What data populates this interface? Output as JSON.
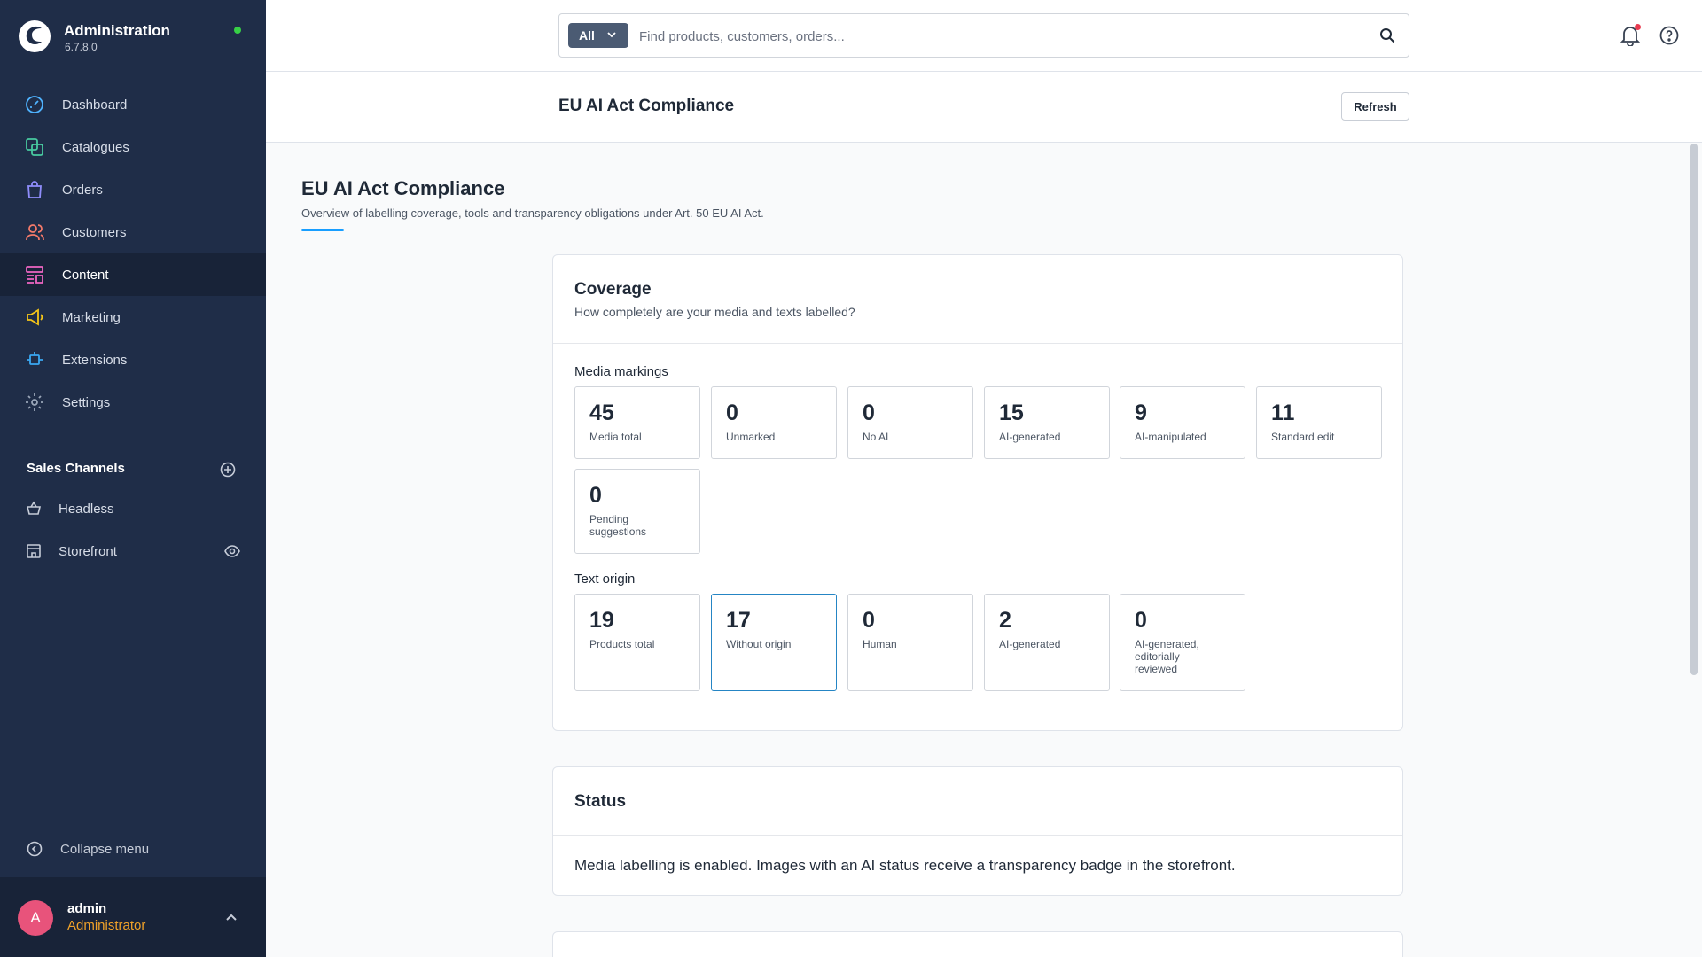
{
  "brand": {
    "name": "Administration",
    "version": "6.7.8.0"
  },
  "nav": [
    {
      "label": "Dashboard",
      "icon": "dashboard-icon"
    },
    {
      "label": "Catalogues",
      "icon": "catalogues-icon"
    },
    {
      "label": "Orders",
      "icon": "orders-icon"
    },
    {
      "label": "Customers",
      "icon": "customers-icon"
    },
    {
      "label": "Content",
      "icon": "content-icon",
      "active": true
    },
    {
      "label": "Marketing",
      "icon": "marketing-icon"
    },
    {
      "label": "Extensions",
      "icon": "extensions-icon"
    },
    {
      "label": "Settings",
      "icon": "settings-icon"
    }
  ],
  "sales_channels": {
    "title": "Sales Channels",
    "items": [
      {
        "label": "Headless",
        "icon": "basket-icon"
      },
      {
        "label": "Storefront",
        "icon": "storefront-icon"
      }
    ]
  },
  "sidebar": {
    "collapse_label": "Collapse menu"
  },
  "user": {
    "initial": "A",
    "name": "admin",
    "role": "Administrator"
  },
  "search": {
    "filter_label": "All",
    "placeholder": "Find products, customers, orders..."
  },
  "page": {
    "header_title": "EU AI Act Compliance",
    "refresh_label": "Refresh",
    "title": "EU AI Act Compliance",
    "subtitle": "Overview of labelling coverage, tools and transparency obligations under Art. 50 EU AI Act."
  },
  "coverage": {
    "title": "Coverage",
    "subtitle": "How completely are your media and texts labelled?",
    "media_label": "Media markings",
    "media": [
      {
        "value": "45",
        "label": "Media total"
      },
      {
        "value": "0",
        "label": "Unmarked"
      },
      {
        "value": "0",
        "label": "No AI"
      },
      {
        "value": "15",
        "label": "AI-generated"
      },
      {
        "value": "9",
        "label": "AI-manipulated"
      },
      {
        "value": "11",
        "label": "Standard edit"
      },
      {
        "value": "0",
        "label": "Pending suggestions"
      }
    ],
    "text_label": "Text origin",
    "text": [
      {
        "value": "19",
        "label": "Products total"
      },
      {
        "value": "17",
        "label": "Without origin"
      },
      {
        "value": "0",
        "label": "Human"
      },
      {
        "value": "2",
        "label": "AI-generated"
      },
      {
        "value": "0",
        "label": "AI-generated, editorially reviewed"
      }
    ]
  },
  "status": {
    "title": "Status",
    "text": "Media labelling is enabled. Images with an AI status receive a transparency badge in the storefront."
  },
  "colors": {
    "accent": "#189eff",
    "sidebar": "#1f2d48",
    "status_online": "#37d046",
    "avatar": "#e8537b",
    "role": "#f0a229"
  }
}
